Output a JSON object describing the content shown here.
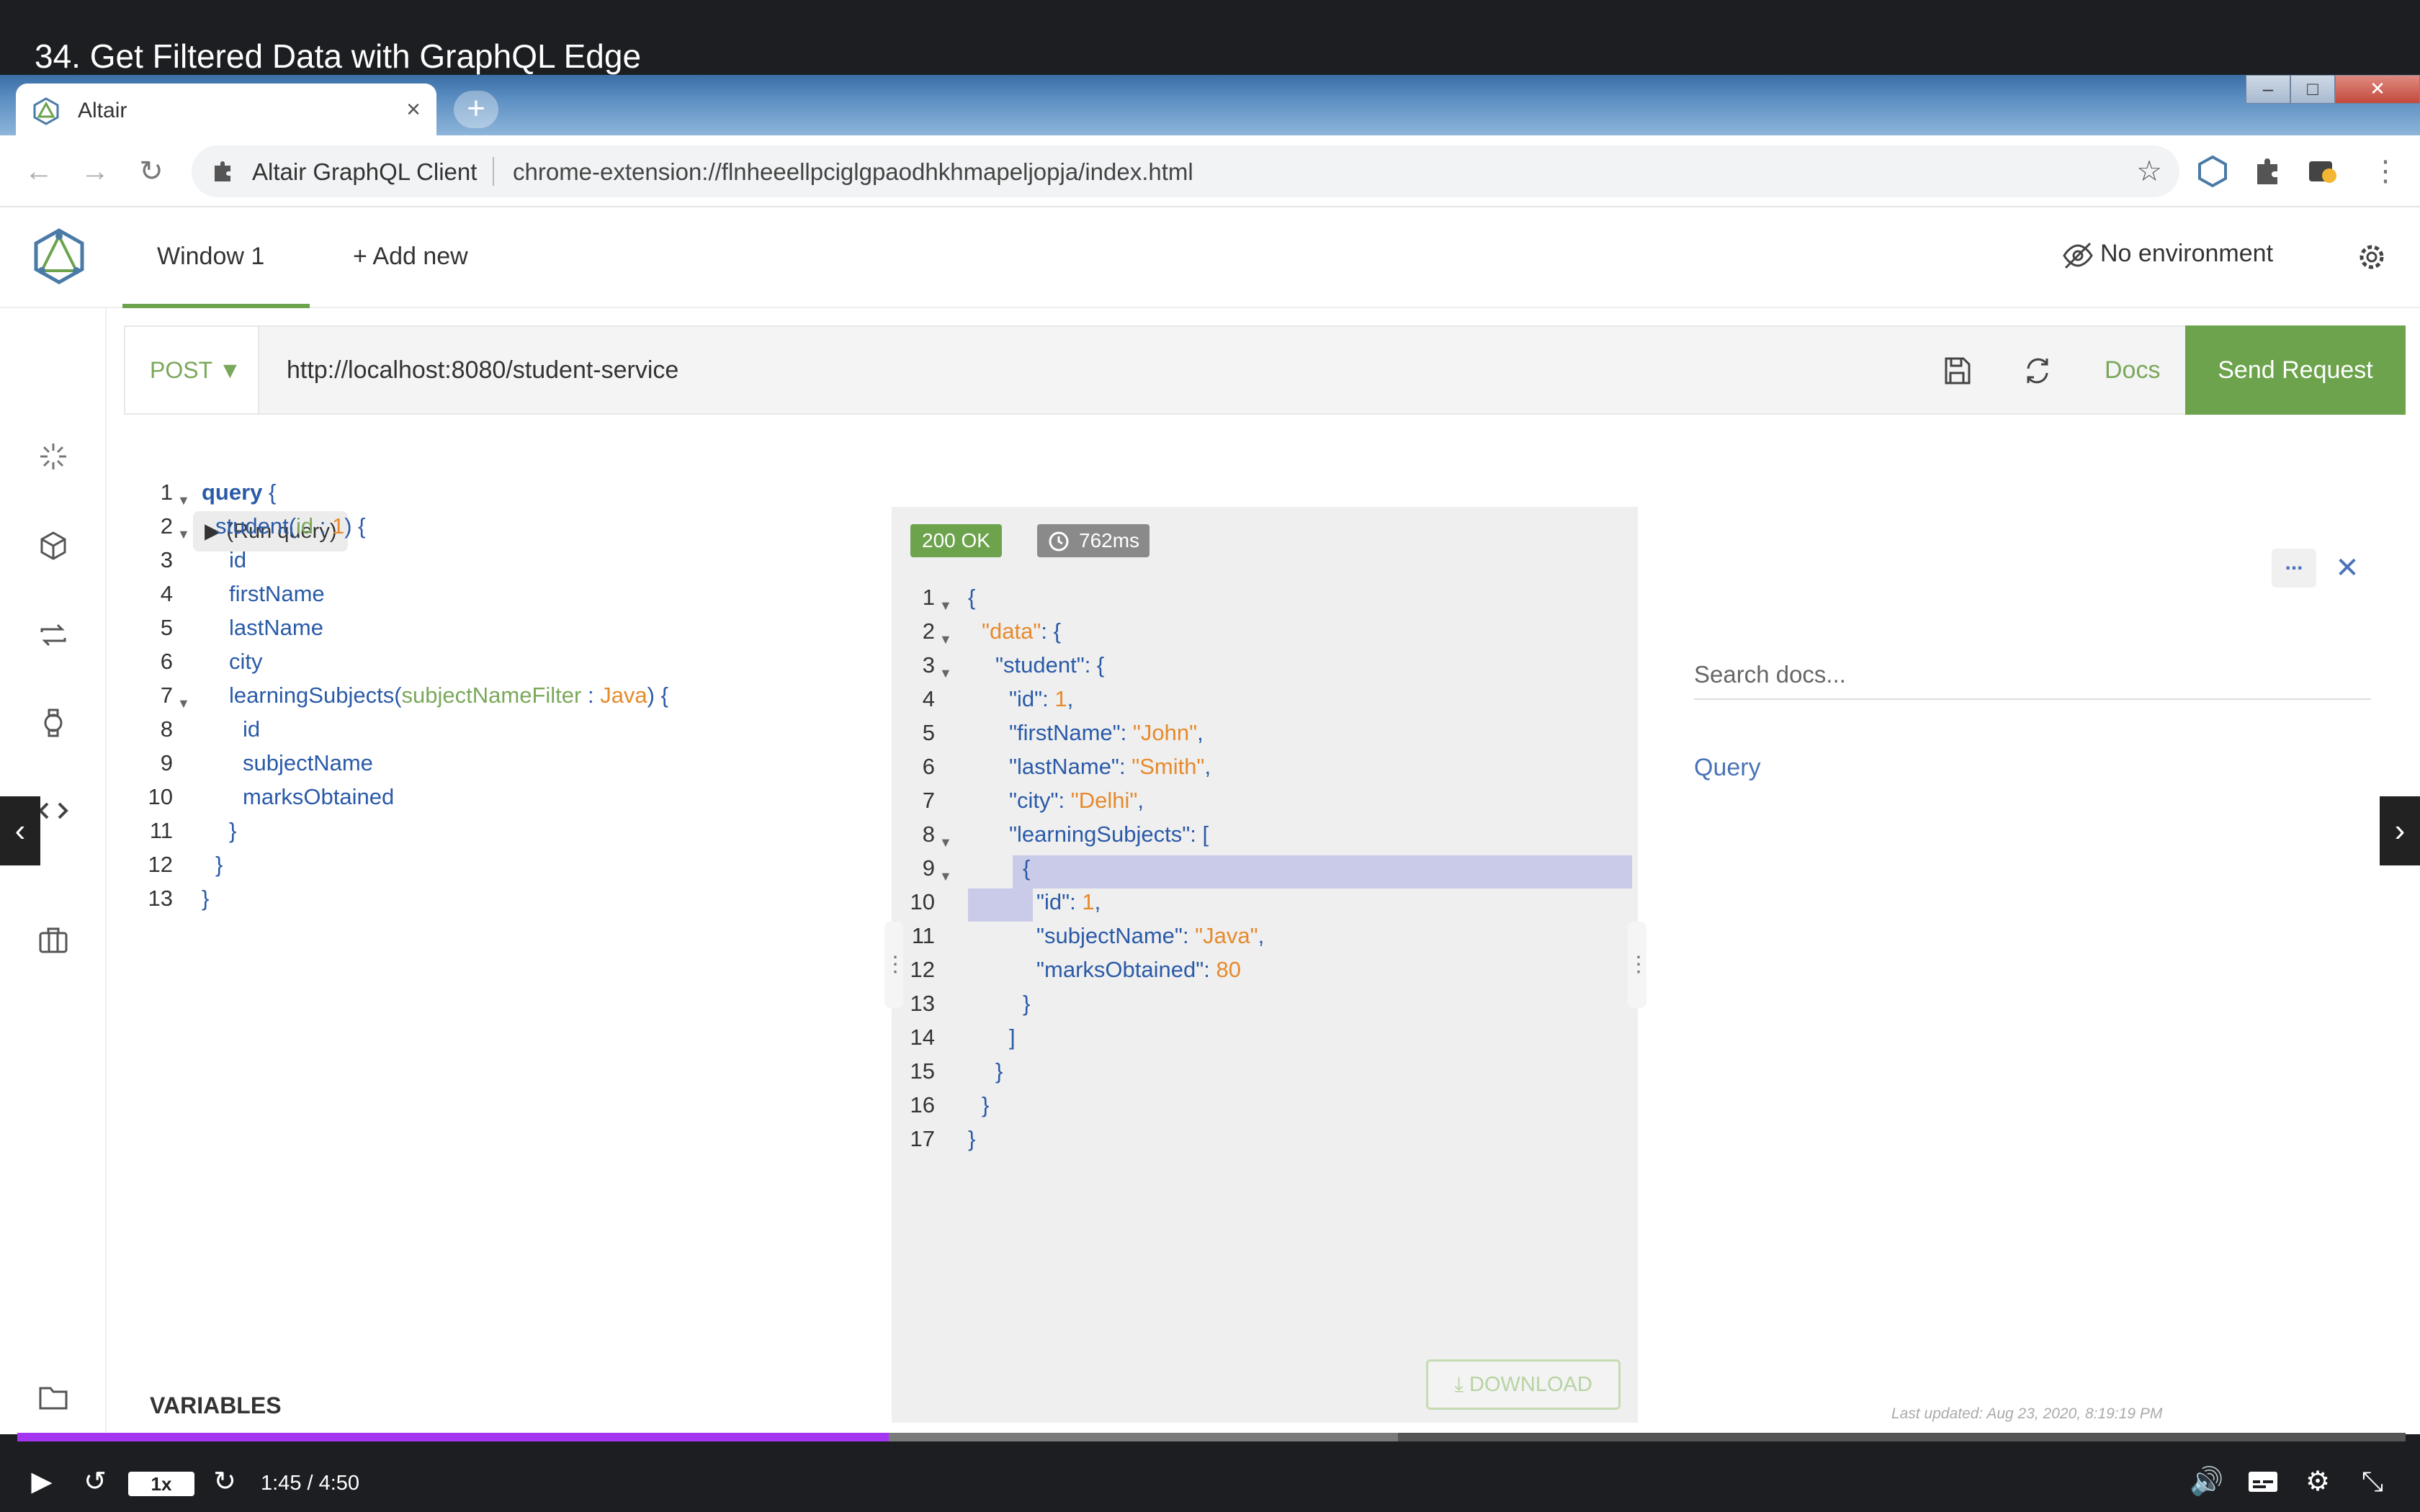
{
  "video": {
    "title": "34. Get Filtered Data with GraphQL Edge",
    "speed": "1x",
    "time": "1:45 / 4:50",
    "progress_played_fraction": 0.365,
    "progress_buffered_fraction": 0.578
  },
  "browser": {
    "tab_title": "Altair",
    "tab_close": "×",
    "new_tab": "+",
    "site_name": "Altair GraphQL Client",
    "url": "chrome-extension://flnheeellpciglgpaodhkhmapeljopja/index.html"
  },
  "app": {
    "window_tab": "Window 1",
    "add_new": "+ Add new",
    "environment": "No environment",
    "method": "POST ▼",
    "endpoint": "http://localhost:8080/student-service",
    "docs_label": "Docs",
    "send_label": "Send Request",
    "run_query": "▶ (Run query)",
    "variables_label": "VARIABLES"
  },
  "query_lines": [
    {
      "n": "1",
      "fold": "▼",
      "indent": 0,
      "tokens": [
        [
          "kw",
          "query"
        ],
        [
          "p",
          " {"
        ]
      ]
    },
    {
      "n": "2",
      "fold": "▼",
      "indent": 1,
      "tokens": [
        [
          "f",
          "student("
        ],
        [
          "arg",
          "id"
        ],
        [
          "p",
          " : "
        ],
        [
          "num",
          "1"
        ],
        [
          "p",
          ") {"
        ]
      ]
    },
    {
      "n": "3",
      "fold": "",
      "indent": 2,
      "tokens": [
        [
          "f",
          "id"
        ]
      ]
    },
    {
      "n": "4",
      "fold": "",
      "indent": 2,
      "tokens": [
        [
          "f",
          "firstName"
        ]
      ]
    },
    {
      "n": "5",
      "fold": "",
      "indent": 2,
      "tokens": [
        [
          "f",
          "lastName"
        ]
      ]
    },
    {
      "n": "6",
      "fold": "",
      "indent": 2,
      "tokens": [
        [
          "f",
          "city"
        ]
      ]
    },
    {
      "n": "7",
      "fold": "▼",
      "indent": 2,
      "tokens": [
        [
          "f",
          "learningSubjects("
        ],
        [
          "arg",
          "subjectNameFilter"
        ],
        [
          "p",
          " : "
        ],
        [
          "num",
          "Java"
        ],
        [
          "p",
          ") {"
        ]
      ]
    },
    {
      "n": "8",
      "fold": "",
      "indent": 3,
      "tokens": [
        [
          "f",
          "id"
        ]
      ]
    },
    {
      "n": "9",
      "fold": "",
      "indent": 3,
      "tokens": [
        [
          "f",
          "subjectName"
        ]
      ]
    },
    {
      "n": "10",
      "fold": "",
      "indent": 3,
      "tokens": [
        [
          "f",
          "marksObtained"
        ]
      ]
    },
    {
      "n": "11",
      "fold": "",
      "indent": 2,
      "tokens": [
        [
          "p",
          "}"
        ]
      ]
    },
    {
      "n": "12",
      "fold": "",
      "indent": 1,
      "tokens": [
        [
          "p",
          "}"
        ]
      ]
    },
    {
      "n": "13",
      "fold": "",
      "indent": 0,
      "tokens": [
        [
          "p",
          "}"
        ]
      ]
    }
  ],
  "result": {
    "status": "200 OK",
    "time": "762ms",
    "download_label": "DOWNLOAD",
    "lines": [
      {
        "n": "1",
        "fold": "▼",
        "indent": 0,
        "tokens": [
          [
            "p",
            "{"
          ]
        ]
      },
      {
        "n": "2",
        "fold": "▼",
        "indent": 1,
        "tokens": [
          [
            "str",
            "\"data\""
          ],
          [
            "p",
            ": {"
          ]
        ]
      },
      {
        "n": "3",
        "fold": "▼",
        "indent": 2,
        "tokens": [
          [
            "key",
            "\"student\""
          ],
          [
            "p",
            ": {"
          ]
        ]
      },
      {
        "n": "4",
        "fold": "",
        "indent": 3,
        "tokens": [
          [
            "key",
            "\"id\""
          ],
          [
            "p",
            ": "
          ],
          [
            "str",
            "1"
          ],
          [
            "p",
            ","
          ]
        ]
      },
      {
        "n": "5",
        "fold": "",
        "indent": 3,
        "tokens": [
          [
            "key",
            "\"firstName\""
          ],
          [
            "p",
            ": "
          ],
          [
            "str",
            "\"John\""
          ],
          [
            "p",
            ","
          ]
        ]
      },
      {
        "n": "6",
        "fold": "",
        "indent": 3,
        "tokens": [
          [
            "key",
            "\"lastName\""
          ],
          [
            "p",
            ": "
          ],
          [
            "str",
            "\"Smith\""
          ],
          [
            "p",
            ","
          ]
        ]
      },
      {
        "n": "7",
        "fold": "",
        "indent": 3,
        "tokens": [
          [
            "key",
            "\"city\""
          ],
          [
            "p",
            ": "
          ],
          [
            "str",
            "\"Delhi\""
          ],
          [
            "p",
            ","
          ]
        ]
      },
      {
        "n": "8",
        "fold": "▼",
        "indent": 3,
        "tokens": [
          [
            "key",
            "\"learningSubjects\""
          ],
          [
            "p",
            ": ["
          ]
        ]
      },
      {
        "n": "9",
        "fold": "▼",
        "indent": 4,
        "tokens": [
          [
            "p",
            "{"
          ]
        ]
      },
      {
        "n": "10",
        "fold": "",
        "indent": 5,
        "tokens": [
          [
            "key",
            "\"id\""
          ],
          [
            "p",
            ": "
          ],
          [
            "str",
            "1"
          ],
          [
            "p",
            ","
          ]
        ]
      },
      {
        "n": "11",
        "fold": "",
        "indent": 5,
        "tokens": [
          [
            "key",
            "\"subjectName\""
          ],
          [
            "p",
            ": "
          ],
          [
            "str",
            "\"Java\""
          ],
          [
            "p",
            ","
          ]
        ]
      },
      {
        "n": "12",
        "fold": "",
        "indent": 5,
        "tokens": [
          [
            "key",
            "\"marksObtained\""
          ],
          [
            "p",
            ": "
          ],
          [
            "str",
            "80"
          ]
        ]
      },
      {
        "n": "13",
        "fold": "",
        "indent": 4,
        "tokens": [
          [
            "p",
            "}"
          ]
        ]
      },
      {
        "n": "14",
        "fold": "",
        "indent": 3,
        "tokens": [
          [
            "p",
            "]"
          ]
        ]
      },
      {
        "n": "15",
        "fold": "",
        "indent": 2,
        "tokens": [
          [
            "p",
            "}"
          ]
        ]
      },
      {
        "n": "16",
        "fold": "",
        "indent": 1,
        "tokens": [
          [
            "p",
            "}"
          ]
        ]
      },
      {
        "n": "17",
        "fold": "",
        "indent": 0,
        "tokens": [
          [
            "p",
            "}"
          ]
        ]
      }
    ]
  },
  "docs": {
    "more": "...",
    "close": "✕",
    "search_placeholder": "Search docs...",
    "query_link": "Query",
    "last_updated": "Last updated: Aug 23, 2020, 8:19:19 PM"
  },
  "colors": {
    "accent_green": "#6ca34c",
    "progress_purple": "#a435f0",
    "selection": "#c9cbe8"
  }
}
